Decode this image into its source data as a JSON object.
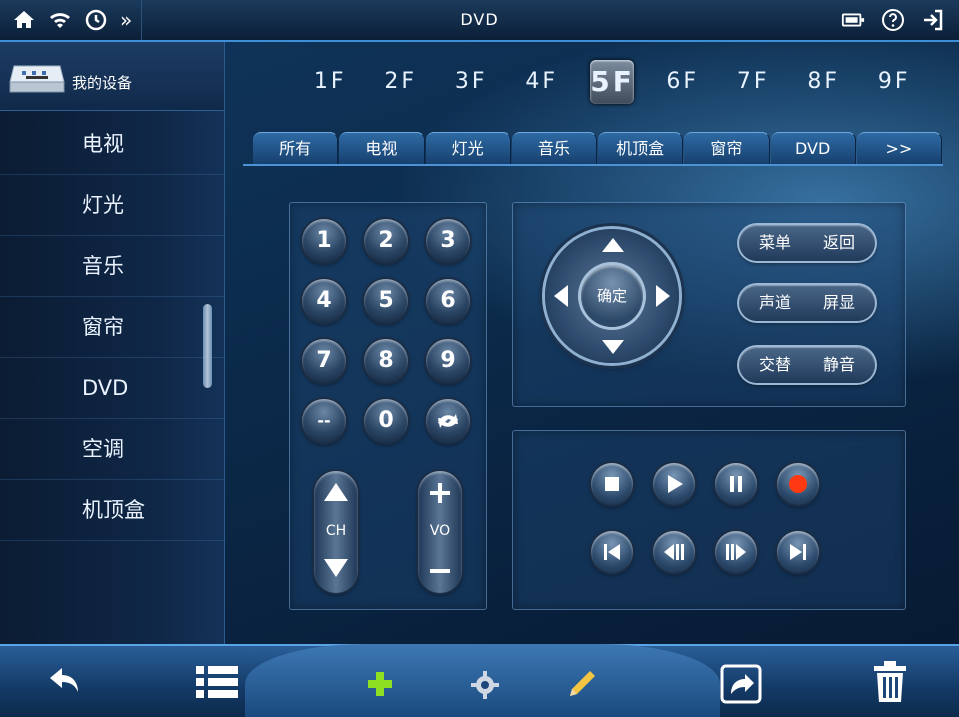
{
  "topbar": {
    "title": "DVD",
    "left_icons": [
      "home-icon",
      "wifi-icon",
      "clock-icon",
      "double-chevron-right-icon"
    ],
    "right_icons": [
      "battery-icon",
      "help-icon",
      "exit-icon"
    ],
    "more_label": "»"
  },
  "sidebar": {
    "header_label": "我的设备",
    "items": [
      {
        "label": "电视"
      },
      {
        "label": "灯光"
      },
      {
        "label": "音乐"
      },
      {
        "label": "窗帘"
      },
      {
        "label": "DVD"
      },
      {
        "label": "空调"
      },
      {
        "label": "机顶盒"
      }
    ]
  },
  "floors": [
    "1F",
    "2F",
    "3F",
    "4F",
    "5F",
    "6F",
    "7F",
    "8F",
    "9F"
  ],
  "active_floor": "5F",
  "tabs": [
    "所有",
    "电视",
    "灯光",
    "音乐",
    "机顶盒",
    "窗帘",
    "DVD",
    ">>"
  ],
  "numpad": {
    "keys": [
      "1",
      "2",
      "3",
      "4",
      "5",
      "6",
      "7",
      "8",
      "9",
      "--",
      "0"
    ],
    "ch_label": "CH",
    "vo_label": "VO"
  },
  "nav": {
    "ok_label": "确定",
    "buttons": [
      {
        "left": "菜单",
        "right": "返回"
      },
      {
        "left": "声道",
        "right": "屏显"
      },
      {
        "left": "交替",
        "right": "静音"
      }
    ]
  },
  "media_icons": [
    "stop-icon",
    "play-icon",
    "pause-icon",
    "record-icon",
    "skip-previous-icon",
    "rewind-icon",
    "fast-forward-icon",
    "skip-next-icon"
  ],
  "colors": {
    "accent": "#3d8fd8",
    "record": "#ff3a12",
    "add": "#8ee022"
  },
  "bottombar": [
    "back-icon",
    "list-icon",
    "add-icon",
    "settings-icon",
    "edit-icon",
    "share-icon",
    "trash-icon"
  ]
}
